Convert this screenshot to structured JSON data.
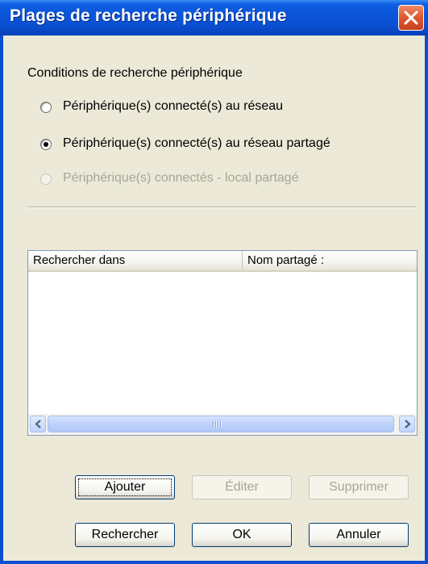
{
  "window": {
    "title": "Plages de recherche périphérique"
  },
  "conditions": {
    "group_label": "Conditions de recherche périphérique",
    "options": [
      {
        "label": "Périphérique(s) connecté(s) au réseau",
        "selected": false,
        "enabled": true
      },
      {
        "label": "Périphérique(s) connecté(s) au réseau partagé",
        "selected": true,
        "enabled": true
      },
      {
        "label": "Périphérique(s) connectés - local partagé",
        "selected": false,
        "enabled": false
      }
    ]
  },
  "list": {
    "columns": [
      "Rechercher dans",
      "Nom partagé :"
    ],
    "rows": []
  },
  "buttons": {
    "add": "Ajouter",
    "edit": "Éditer",
    "delete": "Supprimer",
    "search": "Rechercher",
    "ok": "OK",
    "cancel": "Annuler"
  },
  "icons": {
    "close": "close-icon",
    "scroll_left": "arrow-left-icon",
    "scroll_right": "arrow-right-icon"
  },
  "colors": {
    "titlebar": "#0a4fd0",
    "client": "#ece9d8",
    "close_button": "#e05a34"
  }
}
